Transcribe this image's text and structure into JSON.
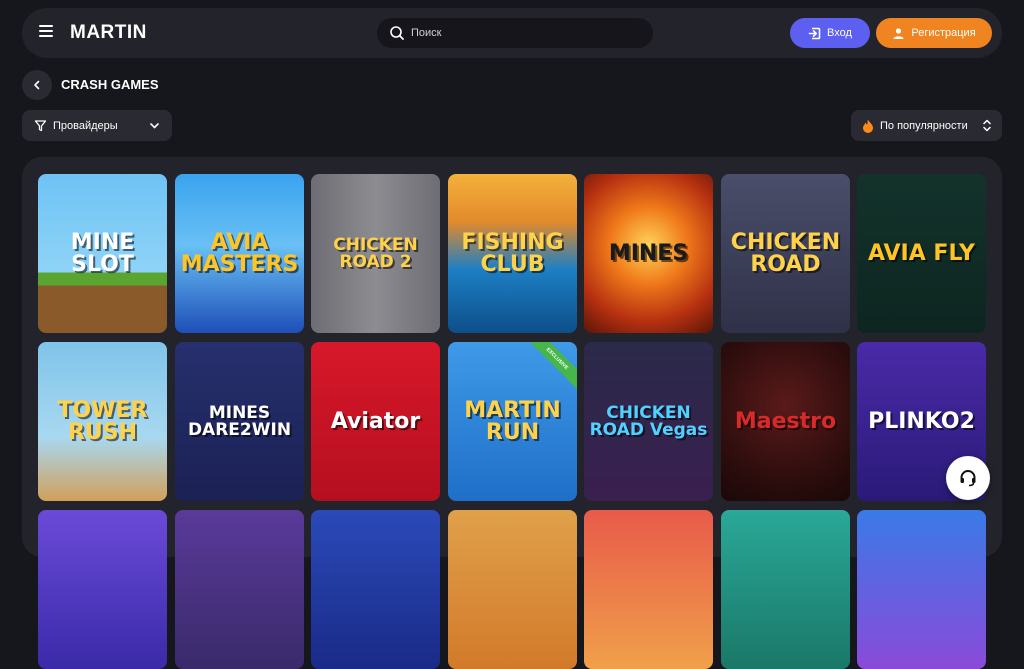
{
  "header": {
    "logo": "MARTIN",
    "search_placeholder": "Поиск",
    "login_label": "Вход",
    "register_label": "Регистрация"
  },
  "page": {
    "title": "CRASH GAMES",
    "providers_label": "Провайдеры",
    "sort_label": "По популярности"
  },
  "games": [
    {
      "title": "MINE SLOT",
      "bg": "linear-gradient(180deg,#6ec3f5 0%,#8fd3f7 62%,#5aa52f 62%,#5aa52f 70%,#8a5a2b 70%)",
      "color": "#ffffff"
    },
    {
      "title": "AVIA MASTERS",
      "bg": "linear-gradient(180deg,#3aa3ef 0%,#69c0f5 45%,#1e4fb8 100%)",
      "color": "#ffc526"
    },
    {
      "title": "CHICKEN ROAD 2",
      "bg": "linear-gradient(90deg,#6d6d73 0%,#8c8c91 50%,#6d6d73 100%)",
      "color": "#ffd24a"
    },
    {
      "title": "FISHING CLUB",
      "bg": "linear-gradient(180deg,#f3b13a 0%,#e28a2c 30%,#1d7fc4 60%,#0d4f8a 100%)",
      "color": "#ffd24a"
    },
    {
      "title": "MINES",
      "bg": "radial-gradient(circle at 50% 45%,#ffd45a 0%,#f07a1a 35%,#b63010 70%,#5a1508 100%)",
      "color": "#1a1a1a"
    },
    {
      "title": "CHICKEN ROAD",
      "bg": "linear-gradient(180deg,#4a4e6a 0%,#2f3148 100%)",
      "color": "#ffd24a"
    },
    {
      "title": "AVIA FLY",
      "bg": "linear-gradient(180deg,#13332b 0%,#0d2520 100%)",
      "color": "#ffc526"
    },
    {
      "title": "TOWER RUSH",
      "bg": "linear-gradient(180deg,#7fc4ea 0%,#a8d8f0 60%,#d1a05a 100%)",
      "color": "#ffd24a"
    },
    {
      "title": "MINES DARE2WIN",
      "bg": "linear-gradient(180deg,#27306e 0%,#1b2154 100%)",
      "color": "#ffffff"
    },
    {
      "title": "Aviator",
      "bg": "linear-gradient(180deg,#d7182a 0%,#b50f1f 100%)",
      "color": "#ffffff"
    },
    {
      "title": "MARTIN RUN",
      "bg": "linear-gradient(180deg,#3f9ae8 0%,#1f6fc8 100%)",
      "color": "#ffd24a",
      "badge": "EXCLUSIVE"
    },
    {
      "title": "CHICKEN ROAD Vegas",
      "bg": "linear-gradient(180deg,#2a2a4a 0%,#3a1f4f 100%)",
      "color": "#4fd2ff"
    },
    {
      "title": "Maestro",
      "bg": "radial-gradient(circle at 50% 40%,#5a1a1a 0%,#2a0c0c 70%,#1a0808 100%)",
      "color": "#d92a2a"
    },
    {
      "title": "PLINKO2",
      "bg": "linear-gradient(180deg,#4a2aa8 0%,#2a1a78 100%)",
      "color": "#ffffff"
    },
    {
      "title": "",
      "bg": "linear-gradient(180deg,#6a4ad8 0%,#3a2aa8 100%)",
      "color": "#ffffff"
    },
    {
      "title": "",
      "bg": "linear-gradient(180deg,#5a3a9a 0%,#3a2a6a 100%)",
      "color": "#ffffff"
    },
    {
      "title": "",
      "bg": "linear-gradient(180deg,#2a4ab8 0%,#1a2a88 100%)",
      "color": "#ffffff"
    },
    {
      "title": "",
      "bg": "linear-gradient(180deg,#e0a04a 0%,#d27a2a 100%)",
      "color": "#ffffff"
    },
    {
      "title": "",
      "bg": "linear-gradient(180deg,#e85a4a 0%,#f0a04a 100%)",
      "color": "#ffffff"
    },
    {
      "title": "",
      "bg": "linear-gradient(180deg,#2aa898 0%,#1a7868 100%)",
      "color": "#ffffff"
    },
    {
      "title": "",
      "bg": "linear-gradient(180deg,#3a7ae8 0%,#8a4ad8 100%)",
      "color": "#ffffff"
    }
  ],
  "colors": {
    "page_bg": "#16161d",
    "panel_bg": "#23232c",
    "login": "#5c5ff0",
    "register": "#f08420",
    "accent": "#ff6a2b"
  },
  "icons": {
    "menu": "hamburger-icon",
    "search": "search-icon",
    "login": "login-arrow-icon",
    "register": "user-icon",
    "back": "chevron-left-icon",
    "filter": "filter-icon",
    "sort": "fire-icon",
    "support": "headset-icon"
  }
}
